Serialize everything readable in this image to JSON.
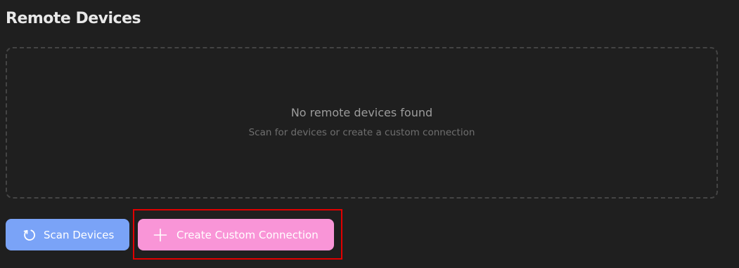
{
  "page": {
    "title": "Remote Devices"
  },
  "empty_state": {
    "title": "No remote devices found",
    "subtitle": "Scan for devices or create a custom connection"
  },
  "actions": {
    "scan_label": "Scan Devices",
    "scan_icon": "refresh-icon",
    "create_label": "Create Custom Connection",
    "create_icon": "plus-icon"
  },
  "colors": {
    "background": "#1f1f1f",
    "scan_button": "#7aa3f7",
    "create_button": "#f995d7",
    "highlight": "#e10000"
  }
}
